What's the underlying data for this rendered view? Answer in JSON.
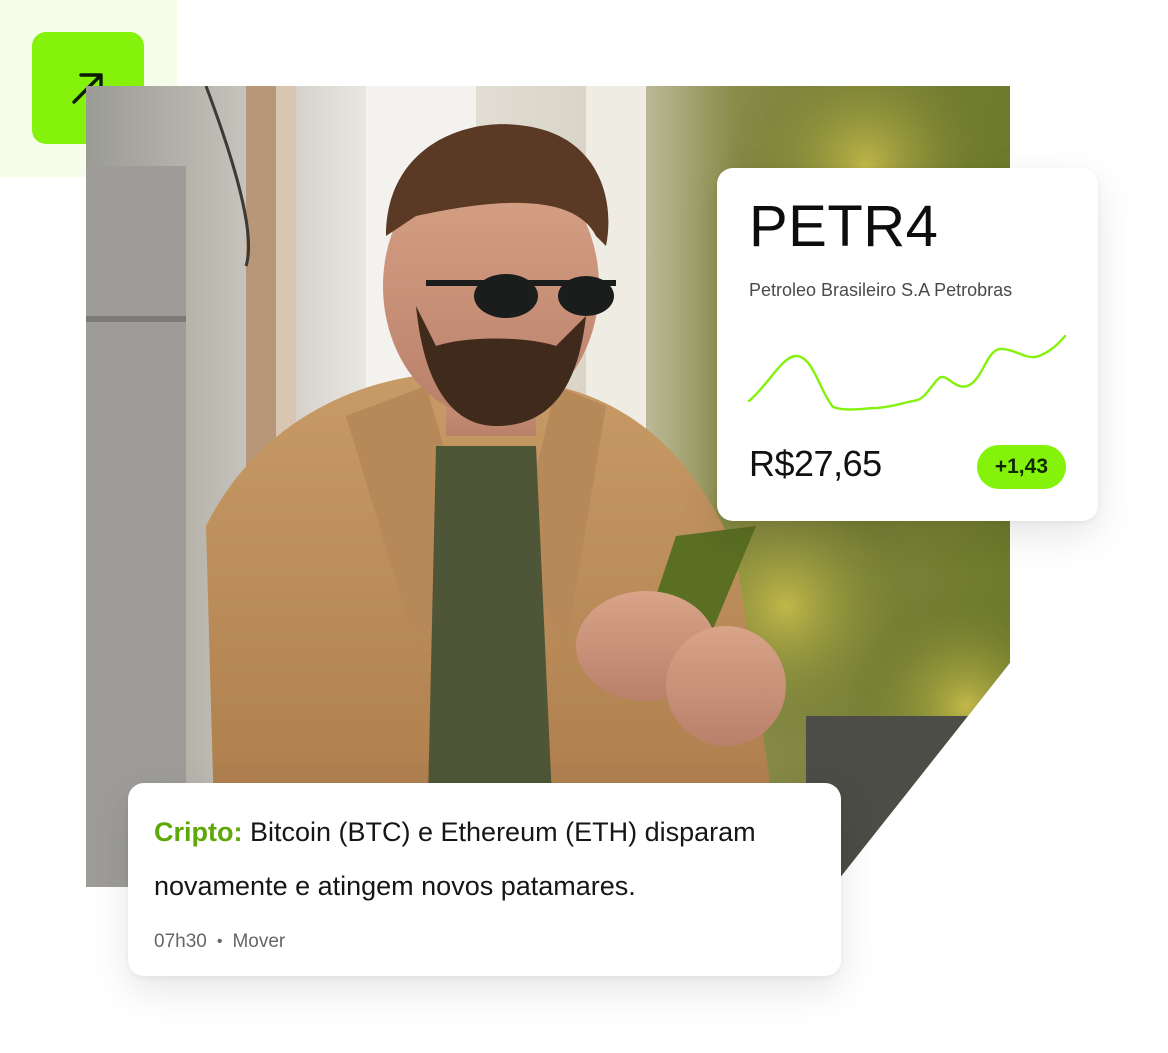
{
  "badge": {
    "icon": "arrow-up-right-icon",
    "color": "#84f20a"
  },
  "stock": {
    "ticker": "PETR4",
    "company": "Petroleo Brasileiro S.A Petrobras",
    "price": "R$27,65",
    "change": "+1,43",
    "accent": "#84f20a"
  },
  "news": {
    "category": "Cripto:",
    "headline": " Bitcoin (BTC) e Ethereum (ETH) disparam novamente e atingem novos patamares.",
    "time": "07h30",
    "separator": "•",
    "source": "Mover",
    "category_color": "#5fa80a"
  }
}
